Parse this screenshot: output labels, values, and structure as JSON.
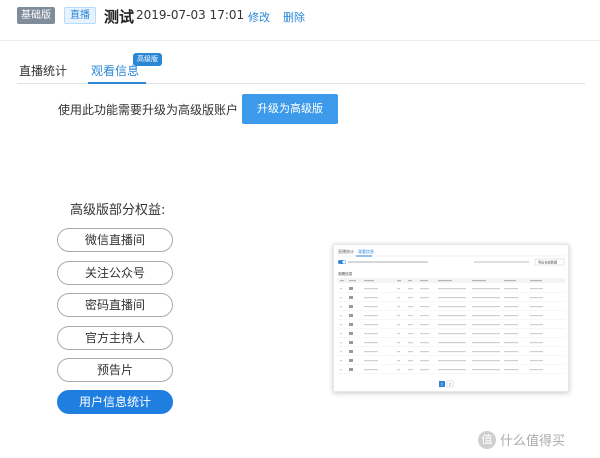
{
  "header": {
    "plan_badge": "基础版",
    "type_badge": "直播",
    "title": "测试",
    "datetime": "2019-07-03 17:01",
    "edit_label": "修改",
    "delete_label": "删除"
  },
  "tabs": [
    {
      "label": "直播统计",
      "active": false
    },
    {
      "label": "观看信息",
      "active": true,
      "badge": "高级版"
    }
  ],
  "upgrade": {
    "notice": "使用此功能需要升级为高级版账户",
    "button_label": "升级为高级版"
  },
  "benefits": {
    "title": "高级版部分权益:",
    "items": [
      {
        "label": "微信直播间",
        "active": false
      },
      {
        "label": "关注公众号",
        "active": false
      },
      {
        "label": "密码直播间",
        "active": false
      },
      {
        "label": "官方主持人",
        "active": false
      },
      {
        "label": "预告片",
        "active": false
      },
      {
        "label": "用户信息统计",
        "active": true
      }
    ]
  },
  "preview": {
    "tabs": [
      "直播统计",
      "观看信息"
    ],
    "section_title": "观看信息",
    "export_label": "导出全部数据",
    "page_numbers": [
      "1",
      "2"
    ],
    "accent_color": "#2b86d6"
  },
  "watermark": {
    "icon": "zhi-icon",
    "text": "什么值得买"
  }
}
